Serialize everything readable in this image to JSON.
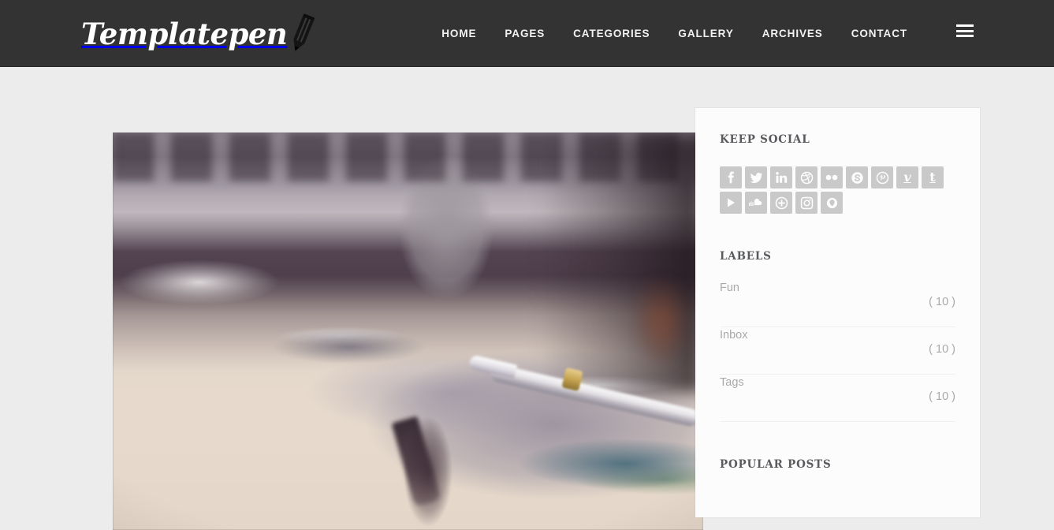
{
  "site": {
    "logo_text": "Templatepen",
    "logo_icon": "pencil-icon"
  },
  "header": {
    "background_color": "#333333",
    "nav_items": [
      {
        "label": "HOME"
      },
      {
        "label": "PAGES"
      },
      {
        "label": "CATEGORIES"
      },
      {
        "label": "GALLERY"
      },
      {
        "label": "ARCHIVES"
      },
      {
        "label": "CONTACT"
      }
    ],
    "menu_toggle_icon": "hamburger-menu-icon"
  },
  "main": {
    "featured_image_alt": "Open notebook with silver pen, smartphone and coffee mug on a desk"
  },
  "sidebar": {
    "background_color": "#fcfcfc",
    "social_widget": {
      "title": "KEEP SOCIAL",
      "tile_color": "#c9c9c9",
      "icons": [
        {
          "name": "facebook-icon"
        },
        {
          "name": "twitter-icon"
        },
        {
          "name": "linkedin-icon"
        },
        {
          "name": "dribbble-icon"
        },
        {
          "name": "flickr-icon"
        },
        {
          "name": "skype-icon"
        },
        {
          "name": "pinterest-icon"
        },
        {
          "name": "vimeo-icon"
        },
        {
          "name": "tumblr-icon"
        },
        {
          "name": "youtube-icon"
        },
        {
          "name": "soundcloud-icon"
        },
        {
          "name": "google-plus-icon"
        },
        {
          "name": "instagram-icon"
        },
        {
          "name": "behance-icon"
        }
      ]
    },
    "labels_widget": {
      "title": "LABELS",
      "items": [
        {
          "name": "Fun",
          "count": "( 10 )"
        },
        {
          "name": "Inbox",
          "count": "( 10 )"
        },
        {
          "name": "Tags",
          "count": "( 10 )"
        }
      ]
    },
    "popular_widget": {
      "title": "POPULAR POSTS"
    }
  },
  "page": {
    "background_color": "#ececec"
  }
}
